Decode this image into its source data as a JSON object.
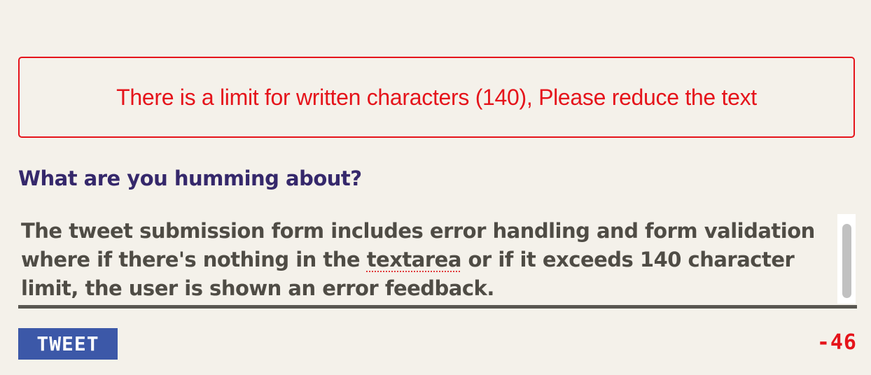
{
  "error": {
    "message": "There is a limit for written characters (140), Please reduce the text"
  },
  "form": {
    "prompt": "What are you humming about?",
    "textarea": {
      "text_before_misspelling": "The tweet submission form includes error handling and form validation where if there's nothing in the ",
      "misspelled_word": "textarea",
      "text_after_misspelling": " or if it exceeds 140 character limit, the user is shown an error feedback."
    },
    "tweet_button_label": "TWEET",
    "char_counter": "-46"
  },
  "colors": {
    "background": "#f4f1ea",
    "error": "#e5141b",
    "prompt": "#35286b",
    "text": "#4f4c45",
    "button": "#3c58a8"
  }
}
